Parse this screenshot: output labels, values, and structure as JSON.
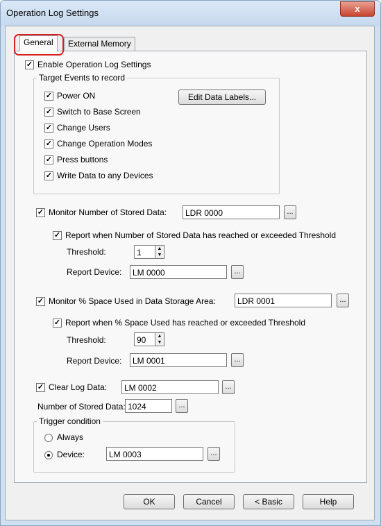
{
  "window": {
    "title": "Operation Log Settings",
    "close_glyph": "x"
  },
  "tabs": [
    {
      "label": "General"
    },
    {
      "label": "External Memory"
    }
  ],
  "enable": {
    "label": "Enable Operation Log Settings"
  },
  "target_events": {
    "legend": "Target Events to record",
    "items": [
      {
        "label": "Power ON"
      },
      {
        "label": "Switch to Base Screen"
      },
      {
        "label": "Change Users"
      },
      {
        "label": "Change Operation Modes"
      },
      {
        "label": "Press buttons"
      },
      {
        "label": "Write Data to any Devices"
      }
    ],
    "edit_button": "Edit Data Labels..."
  },
  "monitor_stored": {
    "label": "Monitor Number of Stored Data:",
    "device": "LDR 0000",
    "report_label": "Report when Number of Stored Data has reached or exceeded Threshold",
    "threshold_label": "Threshold:",
    "threshold_value": "1",
    "report_device_label": "Report Device:",
    "report_device": "LM 0000"
  },
  "monitor_space": {
    "label": "Monitor % Space Used in Data Storage Area:",
    "device": "LDR 0001",
    "report_label": "Report when % Space Used has reached or exceeded Threshold",
    "threshold_label": "Threshold:",
    "threshold_value": "90",
    "report_device_label": "Report Device:",
    "report_device": "LM 0001"
  },
  "clear_log": {
    "label": "Clear Log Data:",
    "device": "LM 0002"
  },
  "stored_count": {
    "label": "Number of Stored Data:",
    "value": "1024"
  },
  "trigger": {
    "legend": "Trigger condition",
    "always_label": "Always",
    "device_label": "Device:",
    "device": "LM 0003"
  },
  "ellipsis": "...",
  "check_glyph": "✓",
  "footer": {
    "ok": "OK",
    "cancel": "Cancel",
    "basic": "< Basic",
    "help": "Help"
  }
}
